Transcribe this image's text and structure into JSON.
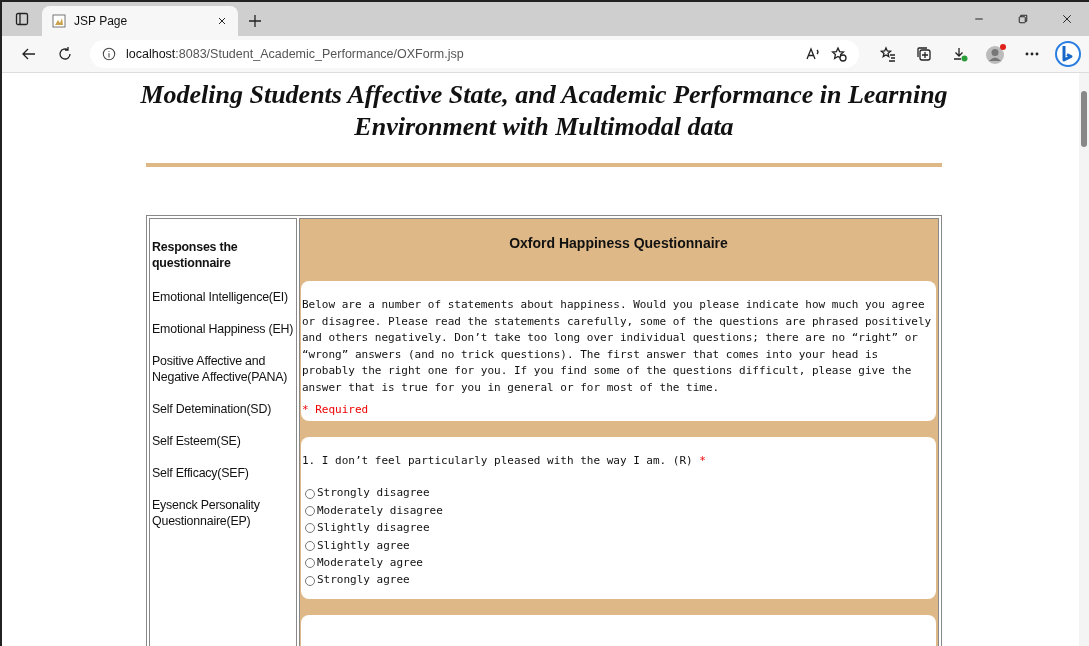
{
  "tab": {
    "title": "JSP Page"
  },
  "address_bar": {
    "host": "localhost",
    "path": ":8083/Student_Academic_Performance/OXForm.jsp"
  },
  "page": {
    "title": "Modeling Students Affective State, and Academic Performance in Learning Environment with Multimodal data",
    "sidebar": {
      "heading": "Responses the questionnaire",
      "items": [
        {
          "label": "Emotional Intelligence(EI)"
        },
        {
          "label": "Emotional Happiness (EH)"
        },
        {
          "label": "Positive Affective and Negative Affective(PANA)"
        },
        {
          "label": "Self Detemination(SD)"
        },
        {
          "label": "Self Esteem(SE)"
        },
        {
          "label": "Self Efficacy(SEF)"
        },
        {
          "label": "Eysenck Personality Questionnaire(EP)"
        }
      ]
    },
    "form": {
      "title": "Oxford Happiness Questionnaire",
      "intro": "Below are a number of statements about happiness. Would you please indicate how much you agree or disagree. Please read the statements carefully, some of the questions are phrased positively and others negatively. Don’t take too long over individual questions; there are no “right” or “wrong” answers (and no trick questions). The first answer that comes into your head is probably the right one for you. If you find some of the questions difficult, please give the answer that is true for you in general or for most of the time.",
      "required_note": "* Required",
      "questions": [
        {
          "text": "1. I don’t feel particularly pleased with the way I am. (R)",
          "required_mark": "*",
          "options": [
            {
              "label": "Strongly disagree",
              "selected": false
            },
            {
              "label": "Moderately disagree",
              "selected": false
            },
            {
              "label": "Slightly disagree",
              "selected": false
            },
            {
              "label": "Slightly agree",
              "selected": false
            },
            {
              "label": "Moderately agree",
              "selected": false
            },
            {
              "label": "Strongly agree",
              "selected": false
            }
          ]
        }
      ]
    }
  }
}
